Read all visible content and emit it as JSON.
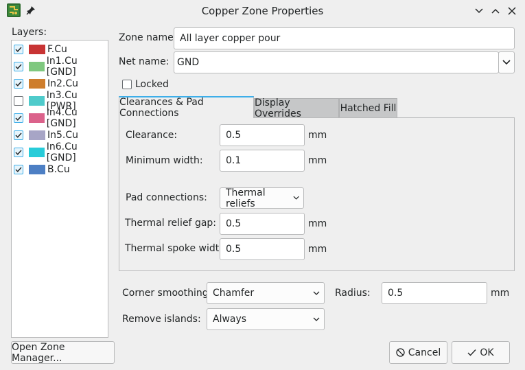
{
  "window": {
    "title": "Copper Zone Properties"
  },
  "layers": {
    "label": "Layers:",
    "items": [
      {
        "name": "F.Cu",
        "checked": true,
        "color": "#c83434"
      },
      {
        "name": "In1.Cu [GND]",
        "checked": true,
        "color": "#7fc87f"
      },
      {
        "name": "In2.Cu",
        "checked": true,
        "color": "#ce7d2c"
      },
      {
        "name": "In3.Cu [PWR]",
        "checked": false,
        "color": "#4fcbcb"
      },
      {
        "name": "In4.Cu [GND]",
        "checked": true,
        "color": "#db628b"
      },
      {
        "name": "In5.Cu",
        "checked": true,
        "color": "#a7a5c6"
      },
      {
        "name": "In6.Cu [GND]",
        "checked": true,
        "color": "#28ccd9"
      },
      {
        "name": "B.Cu",
        "checked": true,
        "color": "#4d7fc4"
      }
    ]
  },
  "zone": {
    "name_label": "Zone name:",
    "name_value": "All layer copper pour",
    "net_label": "Net name:",
    "net_value": "GND",
    "locked_label": "Locked"
  },
  "tabs": [
    "Clearances & Pad Connections",
    "Display Overrides",
    "Hatched Fill"
  ],
  "clearances": {
    "clearance_label": "Clearance:",
    "clearance_value": "0.5",
    "min_width_label": "Minimum width:",
    "min_width_value": "0.1",
    "pad_conn_label": "Pad connections:",
    "pad_conn_value": "Thermal reliefs",
    "relief_gap_label": "Thermal relief gap:",
    "relief_gap_value": "0.5",
    "spoke_width_label": "Thermal spoke width:",
    "spoke_width_value": "0.5",
    "unit": "mm"
  },
  "corner": {
    "smoothing_label": "Corner smoothing:",
    "smoothing_value": "Chamfer",
    "radius_label": "Radius:",
    "radius_value": "0.5",
    "unit": "mm",
    "islands_label": "Remove islands:",
    "islands_value": "Always"
  },
  "buttons": {
    "zone_manager": "Open Zone Manager...",
    "cancel": "Cancel",
    "ok": "OK"
  },
  "colors": {
    "accent": "#3daee9"
  }
}
